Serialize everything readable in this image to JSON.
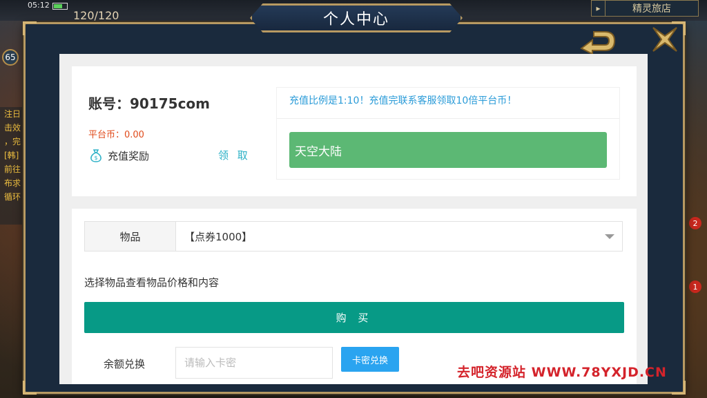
{
  "status_bar": {
    "time": "05:12",
    "energy": "120/120",
    "level": "65"
  },
  "shop": {
    "label": "精灵旅店"
  },
  "left_strip": [
    "注日",
    "击效",
    "，完",
    "[韩]",
    "前往",
    "布求",
    "循环"
  ],
  "badges": [
    "2",
    "1"
  ],
  "modal": {
    "title": "个人中心"
  },
  "account": {
    "label": "账号：90175com",
    "coins": "平台币：0.00",
    "reward_label": "充值奖励",
    "claim_label": "领 取"
  },
  "notice": {
    "text": "充值比例是1:10！充值完联系客服领取10倍平台币！",
    "server_button": "天空大陆"
  },
  "purchase": {
    "item_label": "物品",
    "item_value": "【点券1000】",
    "hint": "选择物品查看物品价格和内容",
    "buy_label": "购 买"
  },
  "redeem": {
    "label": "余额兑换",
    "placeholder": "请输入卡密",
    "button": "卡密兑换"
  },
  "watermark": "去吧资源站  WWW.78YXJD.CN",
  "colors": {
    "frame_gold": "#b89a62",
    "server_green": "#5cb874",
    "buy_teal": "#079a86",
    "redeem_blue": "#2aa4f0",
    "coin_red": "#e04a1a",
    "notice_blue": "#2a9bd8"
  }
}
